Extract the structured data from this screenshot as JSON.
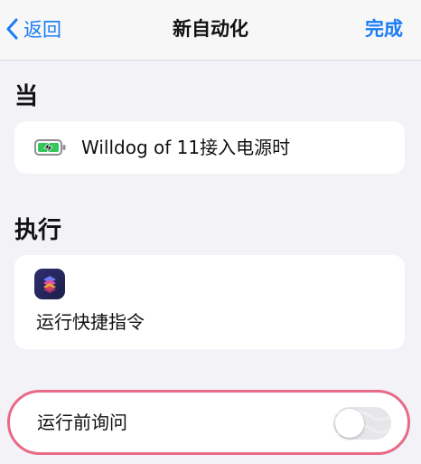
{
  "nav": {
    "back_label": "返回",
    "title": "新自动化",
    "done_label": "完成"
  },
  "when": {
    "section_title": "当",
    "trigger_label": "Willdog of 11接入电源时",
    "icon": "charging-battery-icon"
  },
  "do": {
    "section_title": "执行",
    "action_label": "运行快捷指令",
    "icon": "shortcuts-app-icon"
  },
  "ask_before_running": {
    "label": "运行前询问",
    "enabled": false
  },
  "colors": {
    "accent": "#1a7cf5",
    "background": "#f2f2f7",
    "highlight_ring": "#e86a86",
    "battery_green": "#34c759"
  }
}
